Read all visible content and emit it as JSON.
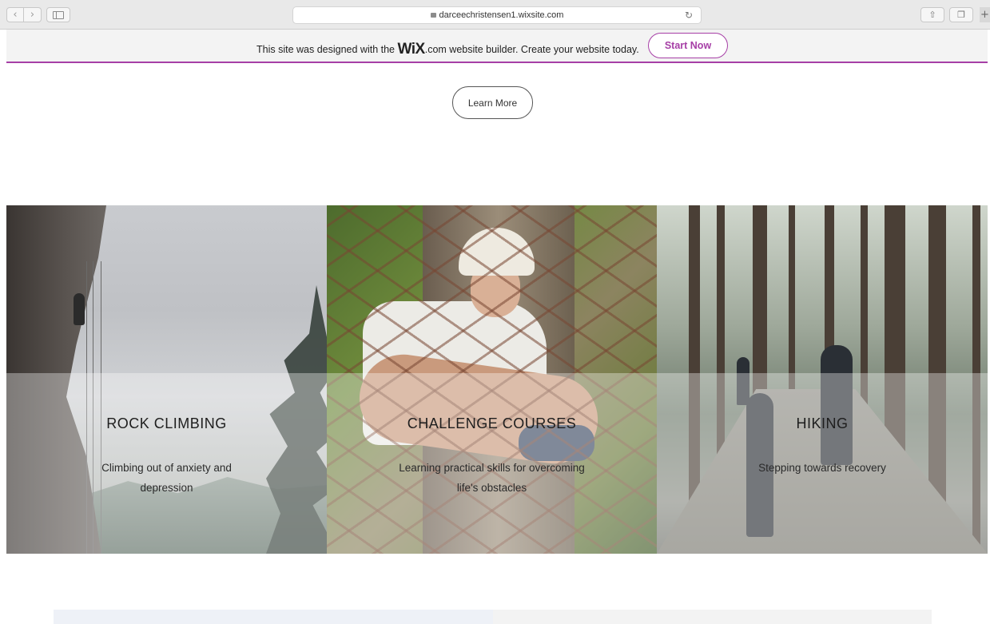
{
  "browser": {
    "url": "darceechristensen1.wixsite.com",
    "back_icon": "chevron-left-icon",
    "forward_icon": "chevron-right-icon",
    "reload_icon": "reload-icon"
  },
  "wix_banner": {
    "text_before": "This site was designed with the",
    "logo": "WiX",
    "logo_suffix": ".com",
    "text_after": "website builder. Create your website today.",
    "start_label": "Start Now",
    "accent": "#a63fa6"
  },
  "hero": {
    "learn_more_label": "Learn More"
  },
  "panels": [
    {
      "title": "ROCK CLIMBING",
      "subtitle": "Climbing out of anxiety and depression"
    },
    {
      "title": "CHALLENGE COURSES",
      "subtitle": "Learning practical skills for overcoming life's obstacles"
    },
    {
      "title": "HIKING",
      "subtitle": "Stepping towards recovery"
    }
  ]
}
